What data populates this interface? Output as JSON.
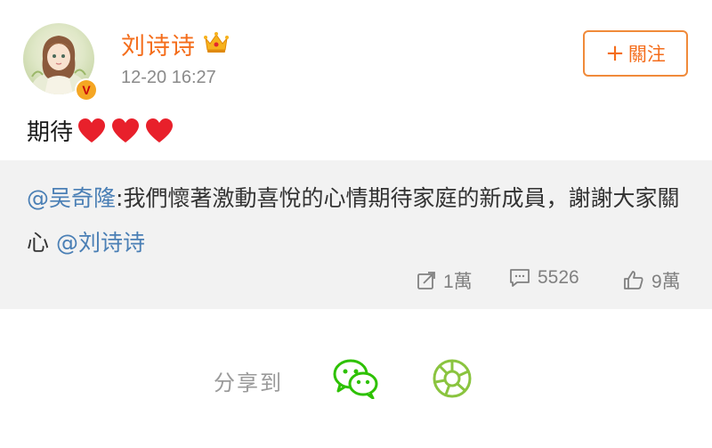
{
  "post": {
    "username": "刘诗诗",
    "timestamp": "12-20 16:27",
    "follow_label": "關注",
    "follow_plus": "+",
    "verified_badge": "V",
    "text": "期待",
    "hearts": 3
  },
  "repost": {
    "mention_author": "@吴奇隆",
    "separator": ":",
    "body": "我們懷著激動喜悅的心情期待家庭的新成員，謝謝大家關心 ",
    "mention_tail": "@刘诗诗"
  },
  "actions": {
    "share_count": "1萬",
    "comment_count": "5526",
    "like_count": "9萬"
  },
  "share": {
    "label": "分享到",
    "targets": [
      "wechat-icon",
      "moments-icon"
    ]
  },
  "colors": {
    "username": "#f46d1b",
    "mention": "#4a7fb5",
    "repost_bg": "#f2f2f2",
    "wechat_green": "#2dc100",
    "moments_green": "#8ac43f"
  }
}
